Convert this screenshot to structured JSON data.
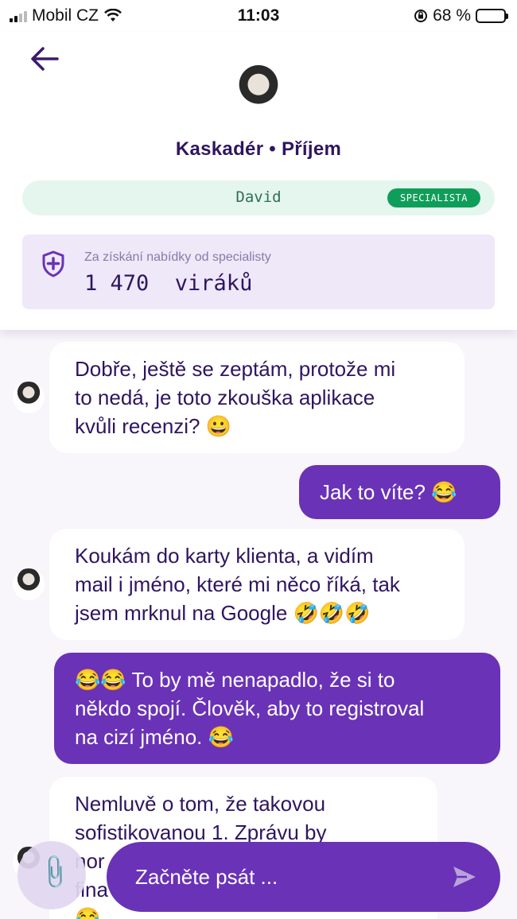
{
  "status_bar": {
    "carrier": "Mobil CZ",
    "time": "11:03",
    "battery": "68 %",
    "battery_level": 0.68
  },
  "header": {
    "title": "Kaskadér • Příjem",
    "specialist_name": "David",
    "specialist_badge": "SPECIALISTA",
    "reward_caption": "Za získání nabídky od specialisty",
    "reward_amount": "1 470  viráků"
  },
  "messages": [
    {
      "side": "in",
      "text": "Dobře, ještě se zeptám, protože mi\nto nedá, je toto zkouška aplikace\nkvůli recenzi? 😀"
    },
    {
      "side": "out",
      "text": "Jak to víte? 😂"
    },
    {
      "side": "in",
      "text": "Koukám do karty klienta, a vidím\nmail i jméno, které mi něco říká, tak\njsem mrknul na Google 🤣🤣🤣"
    },
    {
      "side": "out",
      "text": "😂😂 To by mě nenapadlo, že si to\nněkdo spojí. Člověk, aby to registroval\nna cizí jméno. 😂"
    },
    {
      "side": "in",
      "text": "Nemluvě o tom, že takovou\nsofistikovanou 1. Zprávu by\nnor\nfina\n😂"
    }
  ],
  "composer": {
    "placeholder": "Začněte psát ..."
  },
  "colors": {
    "accent": "#6a32b6",
    "title": "#2f1560",
    "specialist_bg": "#e5f6ee",
    "badge": "#0f9e5a",
    "reward_bg": "#eee8f8",
    "chat_bg": "#f8f5fb"
  },
  "icons": {
    "back": "arrow-left-icon",
    "shield": "shield-plus-icon",
    "attach": "paperclip-icon",
    "send": "send-icon"
  }
}
